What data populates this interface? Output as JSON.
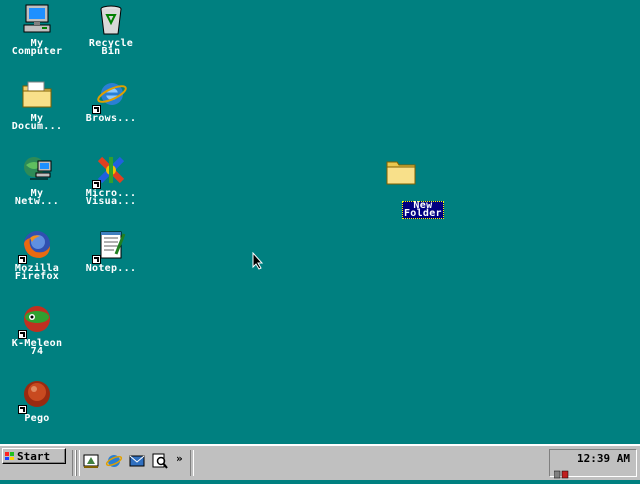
{
  "desktop": {
    "icons": [
      {
        "label": "My\nComputer"
      },
      {
        "label": "Recycle\nBin"
      },
      {
        "label": "My\nDocum..."
      },
      {
        "label": "Brows..."
      },
      {
        "label": "My\nNetw..."
      },
      {
        "label": "Micro...\nVisua..."
      },
      {
        "label": "Mozilla\nFirefox"
      },
      {
        "label": "Notep..."
      },
      {
        "label": "K-Meleon\n74"
      },
      {
        "label": "Pego"
      }
    ],
    "new_folder": {
      "label": "New\nFolder"
    }
  },
  "taskbar": {
    "start_label": "Start",
    "clock": "12:39 AM",
    "chevron": "»"
  }
}
